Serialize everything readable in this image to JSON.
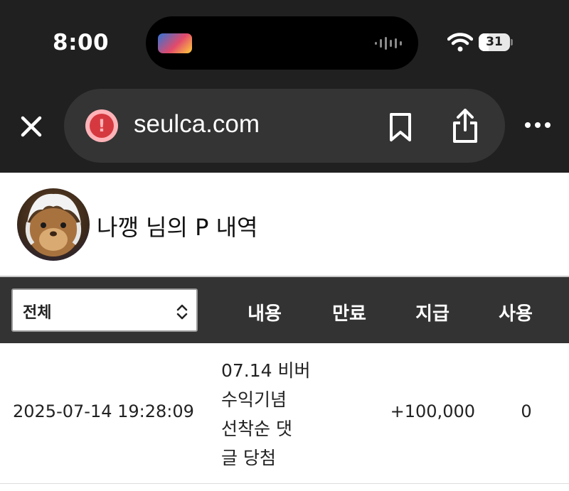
{
  "status_bar": {
    "time": "8:00",
    "battery_level": "31",
    "battery_fraction": 0.31
  },
  "browser": {
    "url": "seulca.com",
    "icons": {
      "close": "close-icon",
      "security": "warning-icon",
      "bookmark": "bookmark-icon",
      "share": "share-icon",
      "more": "more-icon"
    }
  },
  "profile": {
    "title": "나깽 님의 P 내역"
  },
  "table": {
    "filter": {
      "selected": "전체"
    },
    "columns": [
      "내용",
      "만료",
      "지급",
      "사용"
    ],
    "rows": [
      {
        "date": "2025-07-14 19:28:09",
        "content_lines": [
          "07.14 비버",
          "수익기념",
          "선착순 댓",
          "글 당첨"
        ],
        "expired": "",
        "paid": "+100,000",
        "used": "0"
      }
    ]
  },
  "colors": {
    "chrome_bg": "#202020",
    "url_bar_bg": "#343434",
    "header_bg": "#333333",
    "warning": "#d5393f"
  }
}
